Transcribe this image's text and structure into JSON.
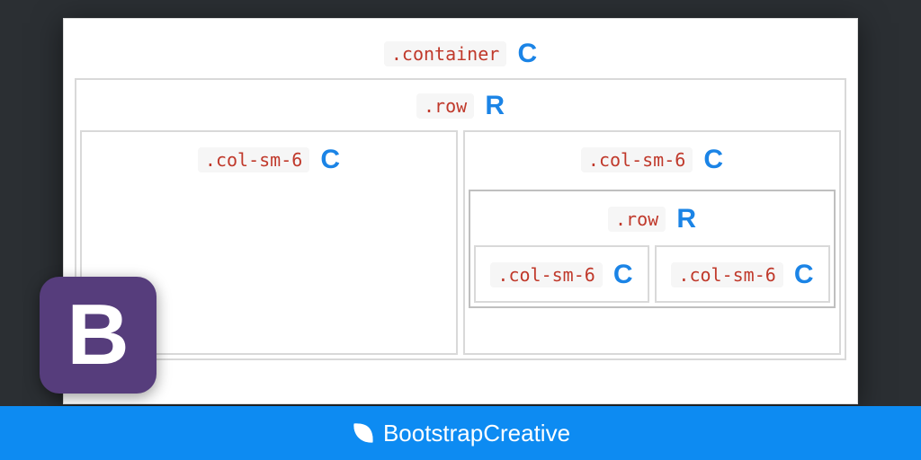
{
  "container": {
    "class": ".container",
    "letter": "C"
  },
  "row": {
    "class": ".row",
    "letter": "R"
  },
  "colA": {
    "class": ".col-sm-6",
    "letter": "C"
  },
  "colB": {
    "class": ".col-sm-6",
    "letter": "C"
  },
  "nestedRow": {
    "class": ".row",
    "letter": "R"
  },
  "nestedColA": {
    "class": ".col-sm-6",
    "letter": "C"
  },
  "nestedColB": {
    "class": ".col-sm-6",
    "letter": "C"
  },
  "footer": {
    "brand": "BootstrapCreative"
  },
  "logo": {
    "letter": "B"
  }
}
